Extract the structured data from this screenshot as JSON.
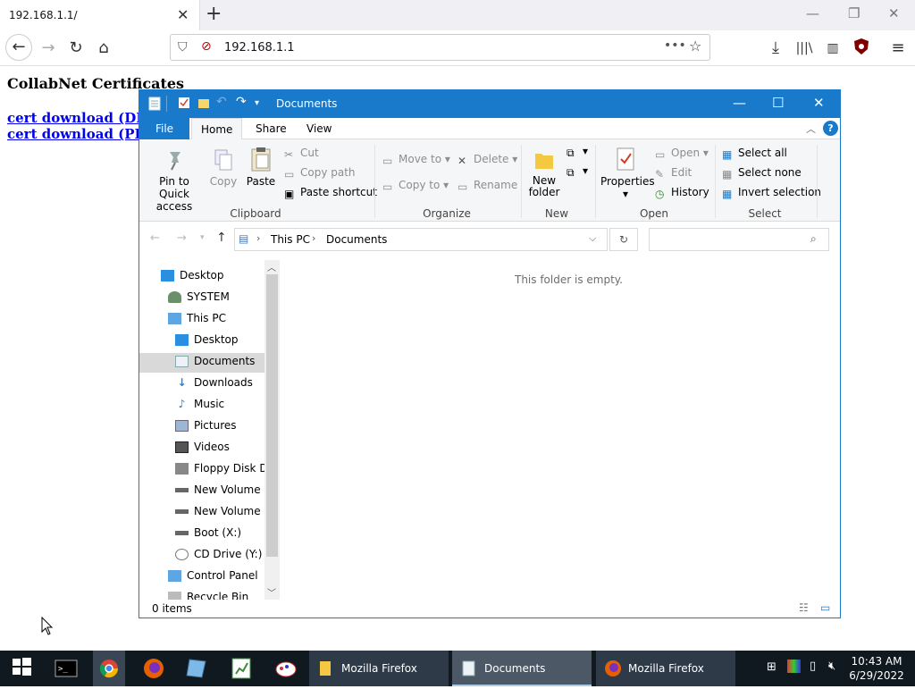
{
  "browser": {
    "tab_title": "192.168.1.1/",
    "url": "192.168.1.1",
    "page": {
      "heading": "CollabNet Certificates",
      "links": [
        "cert download (DER,",
        "cert download (PEM,"
      ]
    }
  },
  "explorer": {
    "title": "Documents",
    "tabs": [
      "File",
      "Home",
      "Share",
      "View"
    ],
    "ribbon": {
      "clipboard": {
        "pin": "Pin to Quick access",
        "copy": "Copy",
        "paste": "Paste",
        "cut": "Cut",
        "copy_path": "Copy path",
        "paste_shortcut": "Paste shortcut",
        "label": "Clipboard"
      },
      "organize": {
        "move_to": "Move to",
        "delete": "Delete",
        "copy_to": "Copy to",
        "rename": "Rename",
        "label": "Organize"
      },
      "new": {
        "new_folder": "New folder",
        "label": "New"
      },
      "open": {
        "properties": "Properties",
        "open": "Open",
        "edit": "Edit",
        "history": "History",
        "label": "Open"
      },
      "select": {
        "select_all": "Select all",
        "select_none": "Select none",
        "invert": "Invert selection",
        "label": "Select"
      }
    },
    "breadcrumb": [
      "This PC",
      "Documents"
    ],
    "nav_items": [
      "Desktop",
      "SYSTEM",
      "This PC",
      "Desktop",
      "Documents",
      "Downloads",
      "Music",
      "Pictures",
      "Videos",
      "Floppy Disk Dri",
      "New Volume (C",
      "New Volume (D",
      "Boot (X:)",
      "CD Drive (Y:) vi",
      "Control Panel",
      "Recycle Bin"
    ],
    "empty_message": "This folder is empty.",
    "status": "0 items"
  },
  "taskbar": {
    "buttons": [
      "Mozilla Firefox",
      "Documents",
      "Mozilla Firefox"
    ],
    "time": "10:43 AM",
    "date": "6/29/2022"
  },
  "colors": {
    "explorer_accent": "#1979ca",
    "taskbar": "#101820"
  }
}
